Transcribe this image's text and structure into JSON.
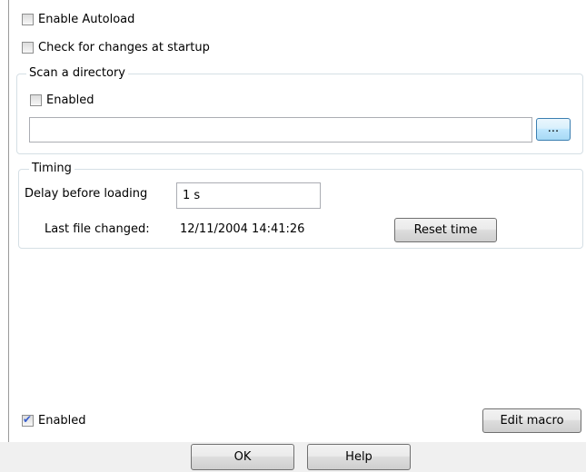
{
  "options": {
    "enable_autoload": {
      "label": "Enable Autoload",
      "checked": false
    },
    "check_startup": {
      "label": "Check for changes at startup",
      "checked": false
    }
  },
  "scan_directory": {
    "legend": "Scan a directory",
    "enabled": {
      "label": "Enabled",
      "checked": false
    },
    "path_value": "",
    "browse_label": "..."
  },
  "timing": {
    "legend": "Timing",
    "delay_label": "Delay before loading",
    "delay_value": "1 s",
    "last_changed_label": "Last file changed:",
    "last_changed_value": "12/11/2004 14:41:26",
    "reset_label": "Reset time"
  },
  "bottom": {
    "enabled": {
      "label": "Enabled",
      "checked": true
    },
    "edit_macro_label": "Edit macro"
  },
  "footer": {
    "ok_label": "OK",
    "help_label": "Help"
  }
}
